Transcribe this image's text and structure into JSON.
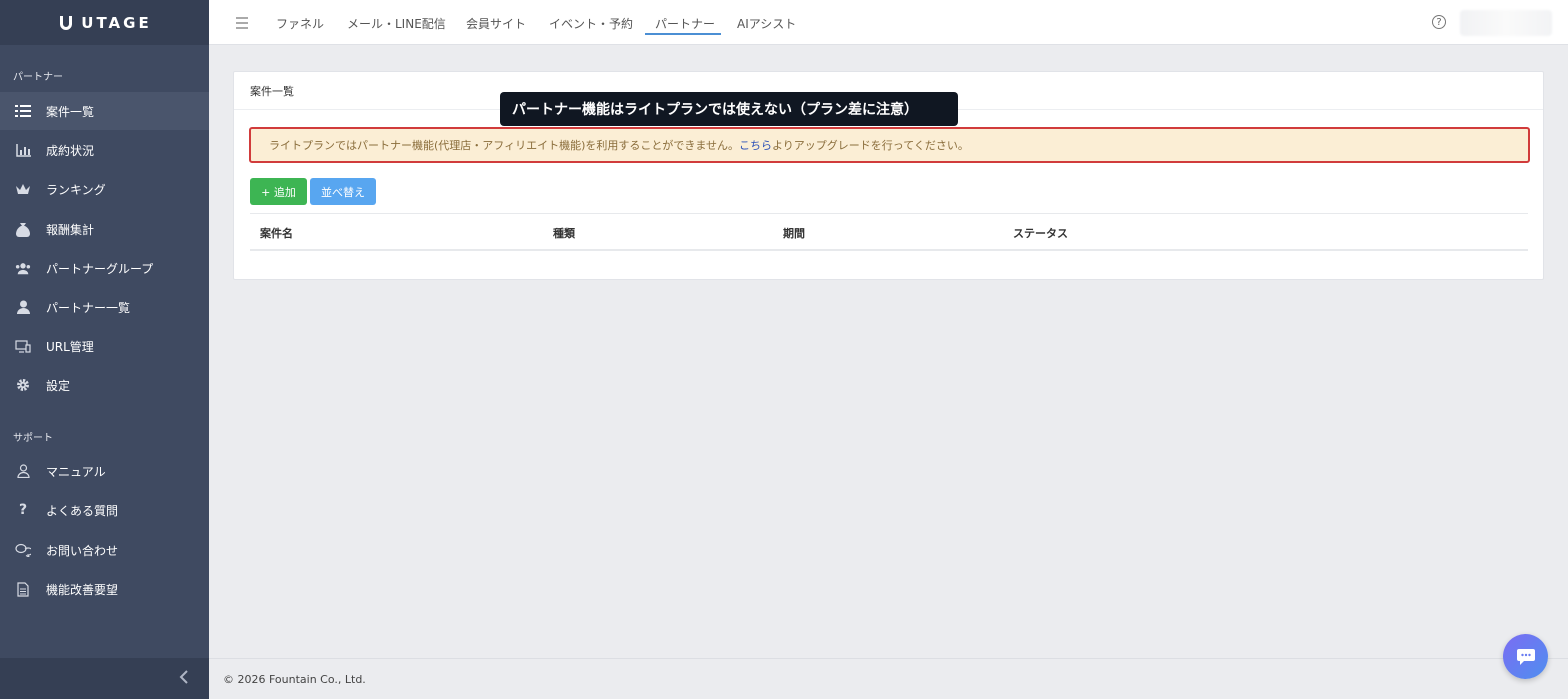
{
  "brand": {
    "name": "UTAGE"
  },
  "sidebar": {
    "section_partner": "パートナー",
    "section_support": "サポート",
    "items": [
      {
        "label": "案件一覧",
        "icon": "list-icon"
      },
      {
        "label": "成約状況",
        "icon": "chart-icon"
      },
      {
        "label": "ランキング",
        "icon": "crown-icon"
      },
      {
        "label": "報酬集計",
        "icon": "money-bag-icon"
      },
      {
        "label": "パートナーグループ",
        "icon": "users-icon"
      },
      {
        "label": "パートナー一覧",
        "icon": "user-icon"
      },
      {
        "label": "URL管理",
        "icon": "monitor-icon"
      },
      {
        "label": "設定",
        "icon": "gear-icon"
      }
    ],
    "support_items": [
      {
        "label": "マニュアル",
        "icon": "person-outline-icon"
      },
      {
        "label": "よくある質問",
        "icon": "question-icon"
      },
      {
        "label": "お問い合わせ",
        "icon": "chat-bubbles-icon"
      },
      {
        "label": "機能改善要望",
        "icon": "document-icon"
      }
    ]
  },
  "topnav": {
    "items": [
      "ファネル",
      "メール・LINE配信",
      "会員サイト",
      "イベント・予約",
      "パートナー",
      "AIアシスト"
    ],
    "active": "パートナー"
  },
  "card": {
    "title": "案件一覧",
    "alert_before": "ライトプランではパートナー機能(代理店・アフィリエイト機能)を利用することができません。",
    "alert_link": "こちら",
    "alert_after": "よりアップグレードを行ってください。",
    "add_button": "+ 追加",
    "sort_button": "並べ替え",
    "columns": [
      "案件名",
      "種類",
      "期間",
      "ステータス"
    ]
  },
  "tooltip": {
    "text": "パートナー機能はライトプランでは使えない（プラン差に注意）"
  },
  "footer": {
    "copyright": "© 2026 Fountain Co., Ltd."
  },
  "colors": {
    "sidebar": "#3f4a61",
    "alert_border": "#d13b3b",
    "add": "#3db553",
    "sort": "#58a6f0",
    "accent": "#4b8fd4"
  }
}
